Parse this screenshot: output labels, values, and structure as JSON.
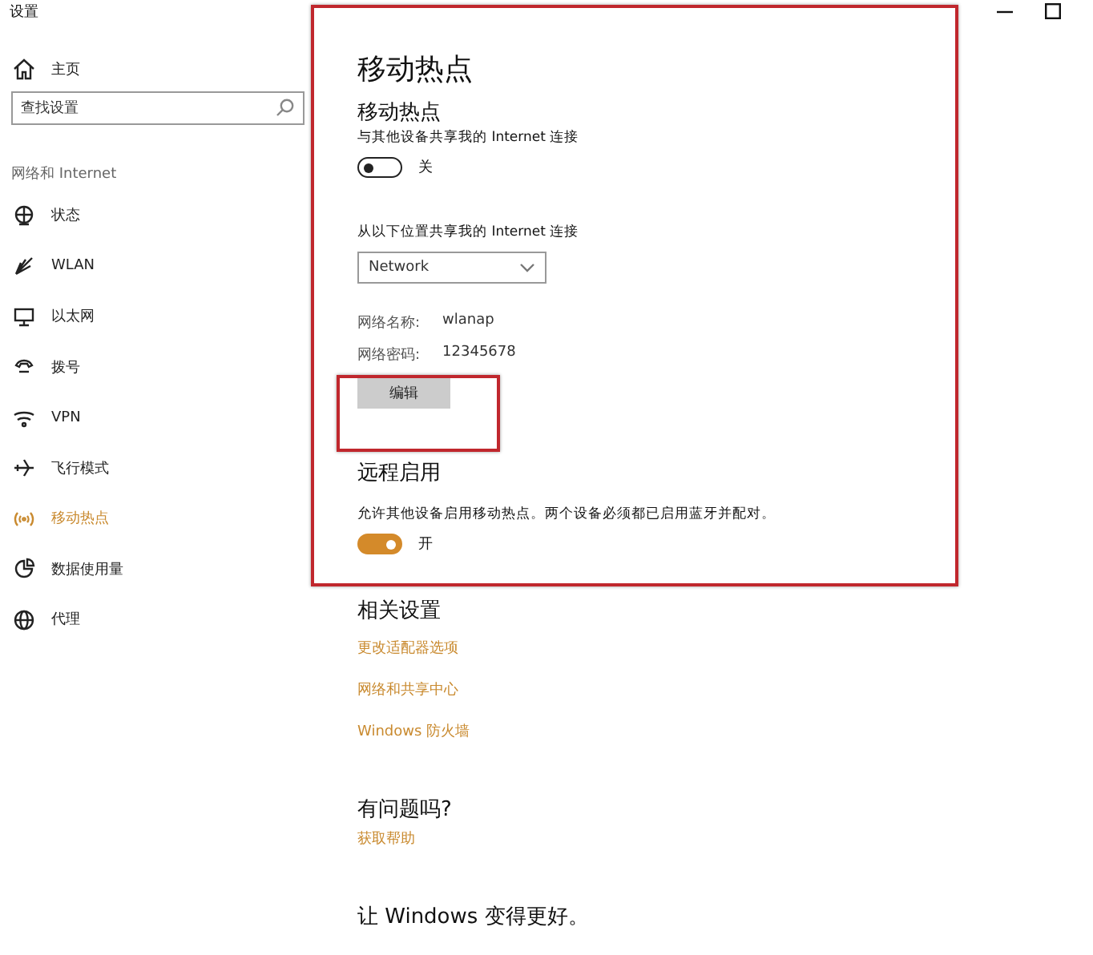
{
  "window": {
    "title": "设置"
  },
  "sidebar": {
    "home": "主页",
    "search": {
      "placeholder": "查找设置"
    },
    "section": "网络和 Internet",
    "items": [
      {
        "label": "状态",
        "selected": false
      },
      {
        "label": "WLAN",
        "selected": false
      },
      {
        "label": "以太网",
        "selected": false
      },
      {
        "label": "拨号",
        "selected": false
      },
      {
        "label": "VPN",
        "selected": false
      },
      {
        "label": "飞行模式",
        "selected": false
      },
      {
        "label": "移动热点",
        "selected": true
      },
      {
        "label": "数据使用量",
        "selected": false
      },
      {
        "label": "代理",
        "selected": false
      }
    ]
  },
  "page": {
    "title": "移动热点",
    "hotspot": {
      "heading": "移动热点",
      "description": "与其他设备共享我的 Internet 连接",
      "toggle": {
        "on": false,
        "label": "关"
      }
    },
    "share_from": {
      "label": "从以下位置共享我的 Internet 连接",
      "value": "Network"
    },
    "details": [
      {
        "label": "网络名称:",
        "value": "wlanap"
      },
      {
        "label": "网络密码:",
        "value": "12345678"
      }
    ],
    "edit_button": "编辑",
    "remote": {
      "heading": "远程启用",
      "description": "允许其他设备启用移动热点。两个设备必须都已启用蓝牙并配对。",
      "toggle": {
        "on": true,
        "label": "开"
      }
    },
    "related": {
      "heading": "相关设置",
      "links": [
        "更改适配器选项",
        "网络和共享中心",
        "Windows 防火墙"
      ]
    },
    "help": {
      "heading": "有问题吗?",
      "link": "获取帮助"
    },
    "feedback": {
      "heading": "让 Windows 变得更好。"
    }
  }
}
